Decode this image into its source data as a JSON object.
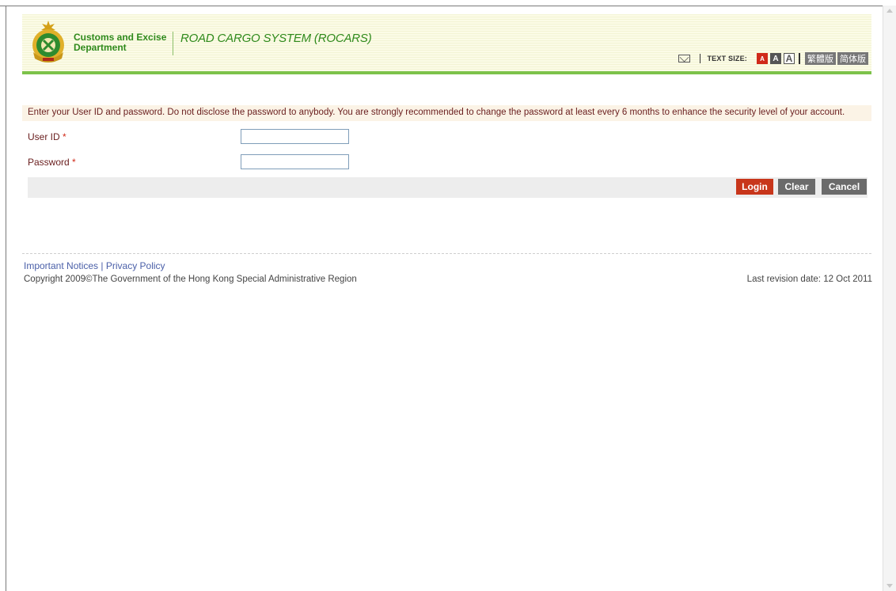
{
  "header": {
    "dept_name": "Customs and Excise Department",
    "system_title": "ROAD CARGO SYSTEM (ROCARS)",
    "text_size_label": "TEXT SIZE:",
    "text_size_small": "A",
    "text_size_medium": "A",
    "text_size_large": "A",
    "lang_traditional": "繁體版",
    "lang_simplified": "简体版"
  },
  "form": {
    "notice": "Enter your User ID and password. Do not disclose the password to anybody. You are strongly recommended to change the password at least every 6 months to enhance the security level of your account.",
    "user_id_label": "User ID",
    "password_label": "Password",
    "required_marker": "*",
    "user_id_value": "",
    "password_value": ""
  },
  "actions": {
    "login": "Login",
    "clear": "Clear",
    "cancel": "Cancel"
  },
  "footer": {
    "important_notices": "Important Notices",
    "link_separator": "|",
    "privacy_policy": "Privacy Policy",
    "copyright": "Copyright 2009©The Government of the Hong Kong Special Administrative Region",
    "revision": "Last revision date: 12 Oct 2011"
  },
  "colors": {
    "brand_green": "#2f8a1c",
    "header_bar": "#7cc24a",
    "login_button": "#c8361b",
    "secondary_button": "#6b6b6b",
    "label_text": "#6b2020"
  },
  "icons": [
    "customs-emblem-icon",
    "mail-icon",
    "scroll-up-icon",
    "scroll-down-icon"
  ]
}
